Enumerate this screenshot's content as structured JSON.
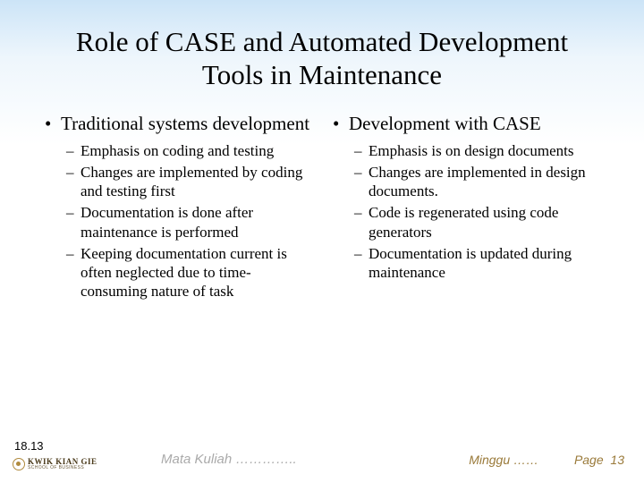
{
  "title": "Role of CASE and Automated Development Tools in Maintenance",
  "left": {
    "heading": "Traditional systems development",
    "items": [
      "Emphasis on coding and testing",
      "Changes are implemented by coding and testing first",
      "Documentation is done after maintenance is performed",
      "Keeping documentation current is often neglected due to time-consuming nature of task"
    ]
  },
  "right": {
    "heading": "Development with CASE",
    "items": [
      "Emphasis is on design documents",
      "Changes are implemented in design documents.",
      "Code is regenerated using code generators",
      "Documentation is updated during maintenance"
    ]
  },
  "footer": {
    "slide_no": "18.13",
    "logo_main": "KWIK KIAN GIE",
    "logo_sub": "SCHOOL OF BUSINESS",
    "mata": "Mata Kuliah …………..",
    "minggu": "Minggu ……",
    "page_label": "Page",
    "page_num": "13"
  }
}
